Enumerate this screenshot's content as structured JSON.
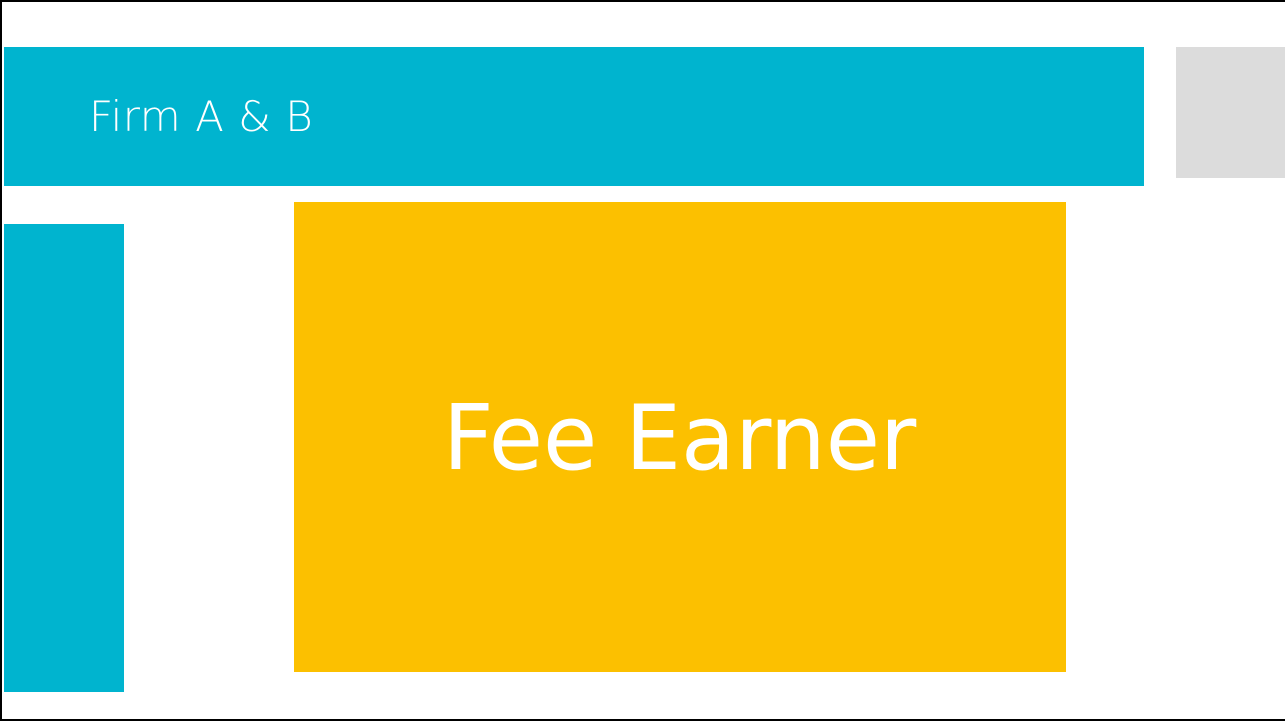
{
  "slide": {
    "title": "Firm A & B",
    "card_label": "Fee Earner"
  },
  "colors": {
    "accent_teal": "#00b4cf",
    "card_gold": "#fcc000",
    "placeholder_gray": "#dcdcdc",
    "text_white": "#ffffff"
  }
}
